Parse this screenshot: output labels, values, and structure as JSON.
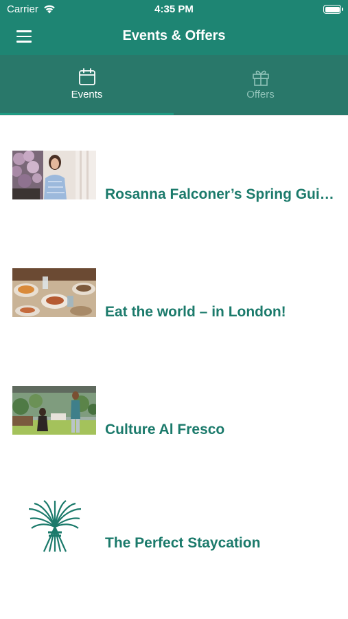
{
  "status_bar": {
    "carrier": "Carrier",
    "time": "4:35 PM"
  },
  "nav": {
    "title": "Events & Offers",
    "menu_icon": "hamburger-menu-icon"
  },
  "tabs": [
    {
      "label": "Events",
      "icon": "calendar-icon",
      "selected": true
    },
    {
      "label": "Offers",
      "icon": "gift-icon",
      "selected": false
    }
  ],
  "events": [
    {
      "title": "Rosanna Falconer’s Spring Guide…",
      "image": "woman-with-flowers-photo"
    },
    {
      "title": "Eat the world – in London!",
      "image": "food-spread-photo"
    },
    {
      "title": "Culture Al Fresco",
      "image": "garden-terrace-photo"
    },
    {
      "title": "The Perfect Staycation",
      "image": "wheat-sheaf-logo"
    }
  ],
  "colors": {
    "header": "#1e8573",
    "tabs": "#29786a",
    "accent_text": "#1b7a6b",
    "inactive_tab": "#8fc2b8"
  }
}
